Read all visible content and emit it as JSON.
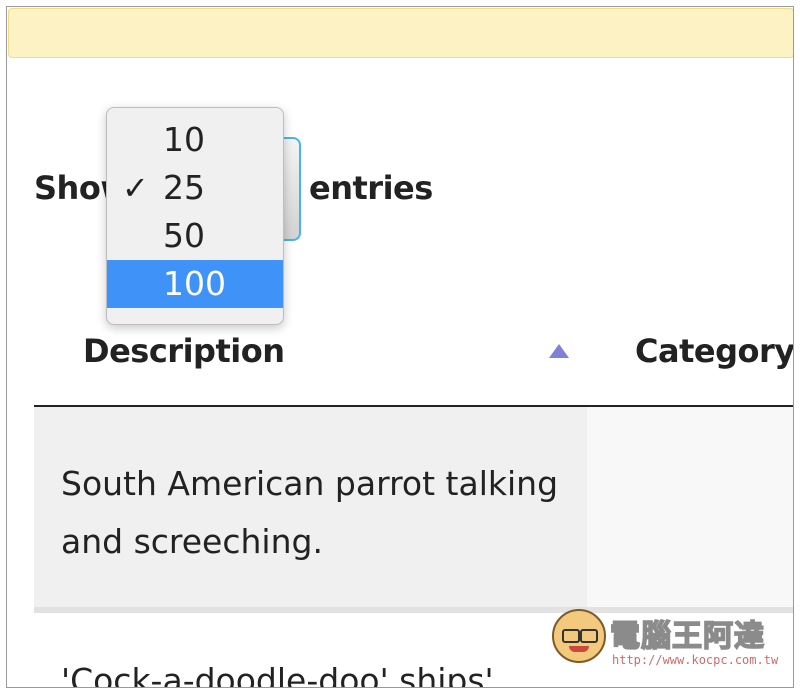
{
  "notice": {
    "text": ""
  },
  "length_control": {
    "prefix": "Show",
    "suffix": "entries",
    "selected": "25",
    "highlighted": "100",
    "options": [
      "10",
      "25",
      "50",
      "100"
    ]
  },
  "table": {
    "columns": [
      "Description",
      "Category"
    ],
    "rows": [
      {
        "description": "South American parrot talking and screeching."
      },
      {
        "description": "'Cock-a-doodle-doo' ships'"
      }
    ]
  },
  "watermark": {
    "title": "電腦王阿達",
    "url": "http://www.kocpc.com.tw"
  },
  "colors": {
    "highlight": "#3f93f8",
    "sort_icon": "#7f80d6",
    "notice_bg": "#fcf2c3",
    "focus_ring": "#4ab3ea"
  }
}
